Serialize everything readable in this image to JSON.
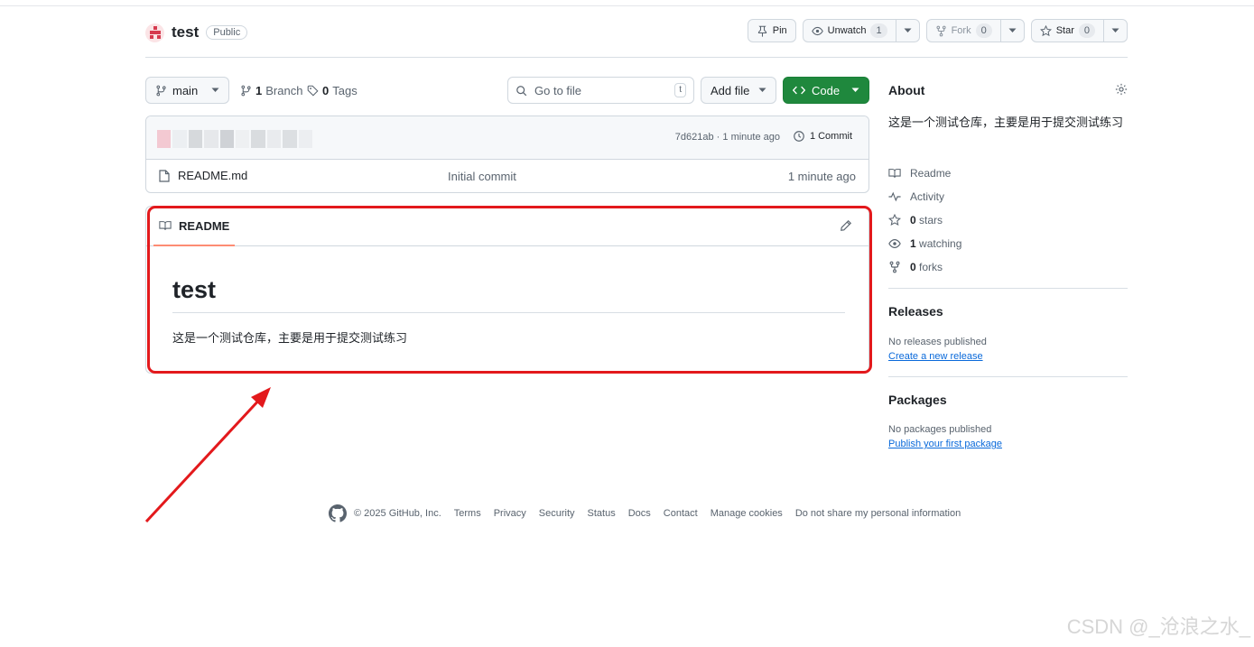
{
  "repo": {
    "name": "test",
    "visibility": "Public",
    "pin_label": "Pin",
    "unwatch_label": "Unwatch",
    "watch_count": "1",
    "fork_label": "Fork",
    "fork_count": "0",
    "star_label": "Star",
    "star_count": "0"
  },
  "toolbar": {
    "branch": "main",
    "branch_count": "1",
    "branch_word": "Branch",
    "tag_count": "0",
    "tag_word": "Tags",
    "goto_placeholder": "Go to file",
    "goto_shortcut": "t",
    "add_file_label": "Add file",
    "code_label": "Code"
  },
  "latest_commit": {
    "meta": "7d621ab · 1 minute ago",
    "commits": "1 Commit"
  },
  "files": [
    {
      "name": "README.md",
      "message": "Initial commit",
      "age": "1 minute ago"
    }
  ],
  "readme": {
    "tab_label": "README",
    "heading": "test",
    "body": "这是一个测试仓库，主要是用于提交测试练习"
  },
  "about": {
    "title": "About",
    "description": "这是一个测试仓库，主要是用于提交测试练习",
    "links": {
      "readme": "Readme",
      "activity": "Activity",
      "stars_count": "0",
      "stars_word": "stars",
      "watching_count": "1",
      "watching_word": "watching",
      "forks_count": "0",
      "forks_word": "forks"
    }
  },
  "releases": {
    "title": "Releases",
    "empty": "No releases published",
    "link": "Create a new release"
  },
  "packages": {
    "title": "Packages",
    "empty": "No packages published",
    "link": "Publish your first package"
  },
  "footer": {
    "copyright": "© 2025 GitHub, Inc.",
    "links": [
      "Terms",
      "Privacy",
      "Security",
      "Status",
      "Docs",
      "Contact",
      "Manage cookies",
      "Do not share my personal information"
    ]
  },
  "watermark": "CSDN @_沧浪之水_",
  "colors": {
    "accent_green": "#1f883d",
    "link_blue": "#0969da",
    "annotation_red": "#e3191c",
    "tab_underline": "#fd8c73"
  }
}
